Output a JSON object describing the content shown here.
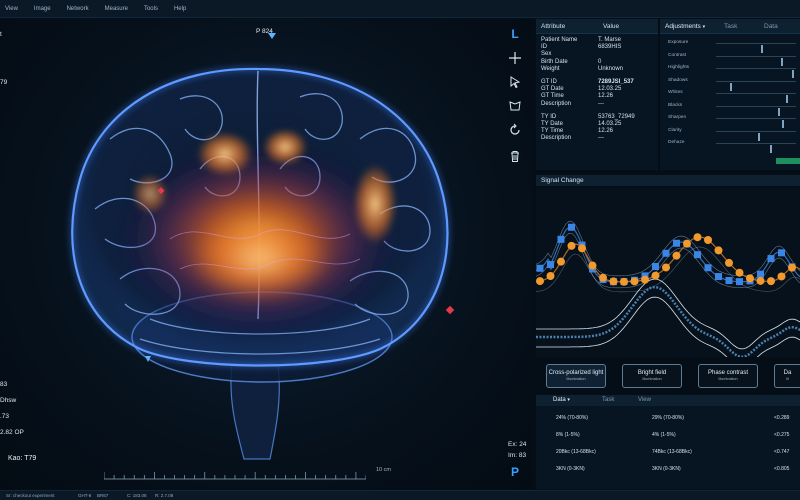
{
  "menu": [
    "View",
    "Image",
    "Network",
    "Measure",
    "Tools",
    "Help"
  ],
  "viewer": {
    "probe_label": "P 824",
    "left_top_labels": [
      "t",
      "79"
    ],
    "left_bottom_labels": [
      "83",
      "Dhsw",
      ".73",
      "2.82 OP",
      "Kao: T79"
    ],
    "right_bottom_labels": [
      "Ex: 24",
      "Im: 83"
    ],
    "scale_label": "10 cm",
    "tool_letters": {
      "top": "L",
      "bottom": "P"
    }
  },
  "attributes": {
    "header": {
      "attribute": "Attribute",
      "value": "Value"
    },
    "groups": [
      [
        {
          "k": "Patient Name",
          "v": "T. Marse"
        },
        {
          "k": "ID",
          "v": "6839HIS"
        },
        {
          "k": "Sex",
          "v": ""
        },
        {
          "k": "Birth Date",
          "v": "0"
        },
        {
          "k": "Weight",
          "v": "Unknown"
        }
      ],
      [
        {
          "k": "GT ID",
          "v": "7289JSI_537"
        },
        {
          "k": "GT Date",
          "v": "12.03.25"
        },
        {
          "k": "GT Time",
          "v": "12.26"
        },
        {
          "k": "Description",
          "v": "---"
        }
      ],
      [
        {
          "k": "TY ID",
          "v": "53763_72949"
        },
        {
          "k": "TY Date",
          "v": "14.03.25"
        },
        {
          "k": "TY Time",
          "v": "12.26"
        },
        {
          "k": "Description",
          "v": "---"
        }
      ]
    ]
  },
  "adjustments": {
    "tabs": [
      "Adjustments",
      "Task",
      "Data"
    ],
    "sliders": [
      {
        "label": "Exposure",
        "value": 0.56
      },
      {
        "label": "Contrast",
        "value": 0.81
      },
      {
        "label": "Highlights",
        "value": 0.95
      },
      {
        "label": "Shadows",
        "value": 0.18
      },
      {
        "label": "Whites",
        "value": 0.88
      },
      {
        "label": "Blacks",
        "value": 0.77
      },
      {
        "label": "Sharpen",
        "value": 0.82
      },
      {
        "label": "Clarity",
        "value": 0.53
      },
      {
        "label": "Dehaze",
        "value": 0.67
      }
    ]
  },
  "signal": {
    "title": "Signal Change",
    "illumination": [
      {
        "title": "Cross-polarized light",
        "sub": "Illumination"
      },
      {
        "title": "Bright field",
        "sub": "Illumination"
      },
      {
        "title": "Phase contrast",
        "sub": "Illumination"
      },
      {
        "title": "Da",
        "sub": "Ill"
      }
    ]
  },
  "data_table": {
    "tabs": [
      "Data",
      "Task",
      "View"
    ],
    "rows": [
      [
        "24% (70-80%)",
        "29% (70-80%)",
        "<0.289"
      ],
      [
        "8% (1-5%)",
        "4% (1-5%)",
        "<0.275"
      ],
      [
        "20Bkc (13-68Bkc)",
        "74Bkc (13-68Bkc)",
        "<0.747"
      ],
      [
        "3KN (0-3KN)",
        "3KN (0-3KN)",
        "<0.805"
      ]
    ]
  },
  "status": [
    "Sr: checkout experiment",
    "GHT-8",
    "BR67",
    "C: 183.08",
    "R: 2.7.08"
  ],
  "colors": {
    "accent": "#2f8dd8",
    "orange": "#f39a2e",
    "blue_marker": "#3a86e6",
    "green": "#1f8f5f"
  }
}
